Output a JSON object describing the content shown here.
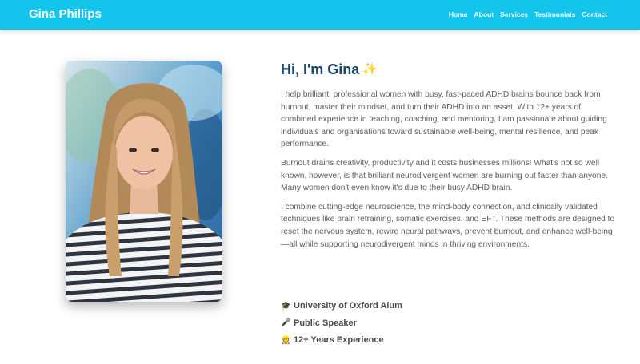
{
  "nav": {
    "brand": "Gina Phillips",
    "links": [
      "Home",
      "About",
      "Services",
      "Testimonials",
      "Contact"
    ]
  },
  "about": {
    "greeting": "Hi, I'm Gina",
    "greeting_emoji": "✨",
    "paragraphs": [
      "I help brilliant, professional women with busy, fast-paced ADHD brains bounce back from burnout, master their mindset, and turn their ADHD into an asset. With 12+ years of combined experience in teaching, coaching, and mentoring, I am passionate about guiding individuals and organisations toward sustainable well-being, mental resilience, and peak performance.",
      "Burnout drains creativity, productivity and it costs businesses millions! What's not so well known, however, is that brilliant neurodivergent women are burning out faster than anyone. Many women don't even know it's due to their busy ADHD brain.",
      "I combine cutting-edge neuroscience, the mind-body connection, and clinically validated techniques like brain retraining, somatic exercises, and EFT. These methods are designed to reset the nervous system, rewire neural pathways, prevent burnout, and enhance well-being—all while supporting neurodivergent minds in thriving environments."
    ]
  },
  "credentials": [
    {
      "icon": "🎓",
      "icon_name": "graduation-cap-icon",
      "label": "University of Oxford Alum"
    },
    {
      "icon": "🎤",
      "icon_name": "microphone-icon",
      "label": "Public Speaker"
    },
    {
      "icon": "👷",
      "icon_name": "worker-icon",
      "label": "12+ Years Experience"
    }
  ],
  "colors": {
    "navbar": "#13c5ec",
    "heading": "#1d4769",
    "body_text": "#5d5d5d"
  }
}
